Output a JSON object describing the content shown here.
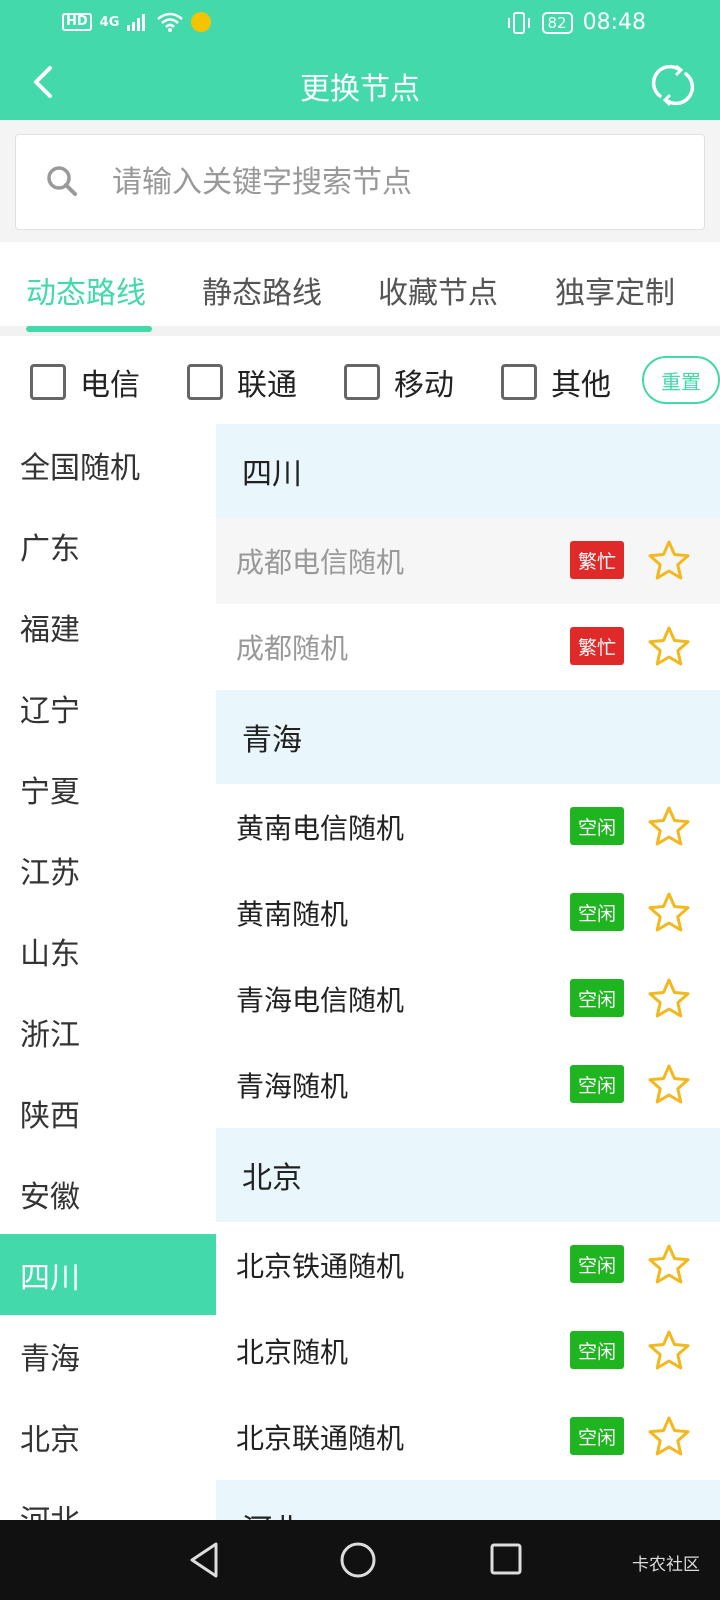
{
  "status_bar": {
    "network": "HD",
    "signal": "4G",
    "battery": "82",
    "time": "08:48"
  },
  "header": {
    "title": "更换节点"
  },
  "search": {
    "placeholder": "请输入关键字搜索节点"
  },
  "tabs": [
    {
      "label": "动态路线",
      "active": true
    },
    {
      "label": "静态路线",
      "active": false
    },
    {
      "label": "收藏节点",
      "active": false
    },
    {
      "label": "独享定制",
      "active": false
    }
  ],
  "filters": {
    "options": [
      {
        "label": "电信",
        "checked": false
      },
      {
        "label": "联通",
        "checked": false
      },
      {
        "label": "移动",
        "checked": false
      },
      {
        "label": "其他",
        "checked": false
      }
    ],
    "reset_label": "重置"
  },
  "sidebar": {
    "items": [
      {
        "label": "全国随机"
      },
      {
        "label": "广东"
      },
      {
        "label": "福建"
      },
      {
        "label": "辽宁"
      },
      {
        "label": "宁夏"
      },
      {
        "label": "江苏"
      },
      {
        "label": "山东"
      },
      {
        "label": "浙江"
      },
      {
        "label": "陕西"
      },
      {
        "label": "安徽"
      },
      {
        "label": "四川",
        "active": true
      },
      {
        "label": "青海"
      },
      {
        "label": "北京"
      },
      {
        "label": "河北"
      }
    ]
  },
  "groups": [
    {
      "name": "四川",
      "nodes": [
        {
          "name": "成都电信随机",
          "status": "繁忙",
          "status_type": "busy"
        },
        {
          "name": "成都随机",
          "status": "繁忙",
          "status_type": "busy"
        }
      ]
    },
    {
      "name": "青海",
      "nodes": [
        {
          "name": "黄南电信随机",
          "status": "空闲",
          "status_type": "idle"
        },
        {
          "name": "黄南随机",
          "status": "空闲",
          "status_type": "idle"
        },
        {
          "name": "青海电信随机",
          "status": "空闲",
          "status_type": "idle"
        },
        {
          "name": "青海随机",
          "status": "空闲",
          "status_type": "idle"
        }
      ]
    },
    {
      "name": "北京",
      "nodes": [
        {
          "name": "北京铁通随机",
          "status": "空闲",
          "status_type": "idle"
        },
        {
          "name": "北京随机",
          "status": "空闲",
          "status_type": "idle"
        },
        {
          "name": "北京联通随机",
          "status": "空闲",
          "status_type": "idle"
        }
      ]
    },
    {
      "name": "河北",
      "nodes": []
    }
  ],
  "watermark": "卡农社区",
  "colors": {
    "accent": "#43d9aa",
    "busy": "#e02a2a",
    "idle": "#1fb520",
    "star": "#f2b81f",
    "group_bg": "#e9f6fb"
  }
}
